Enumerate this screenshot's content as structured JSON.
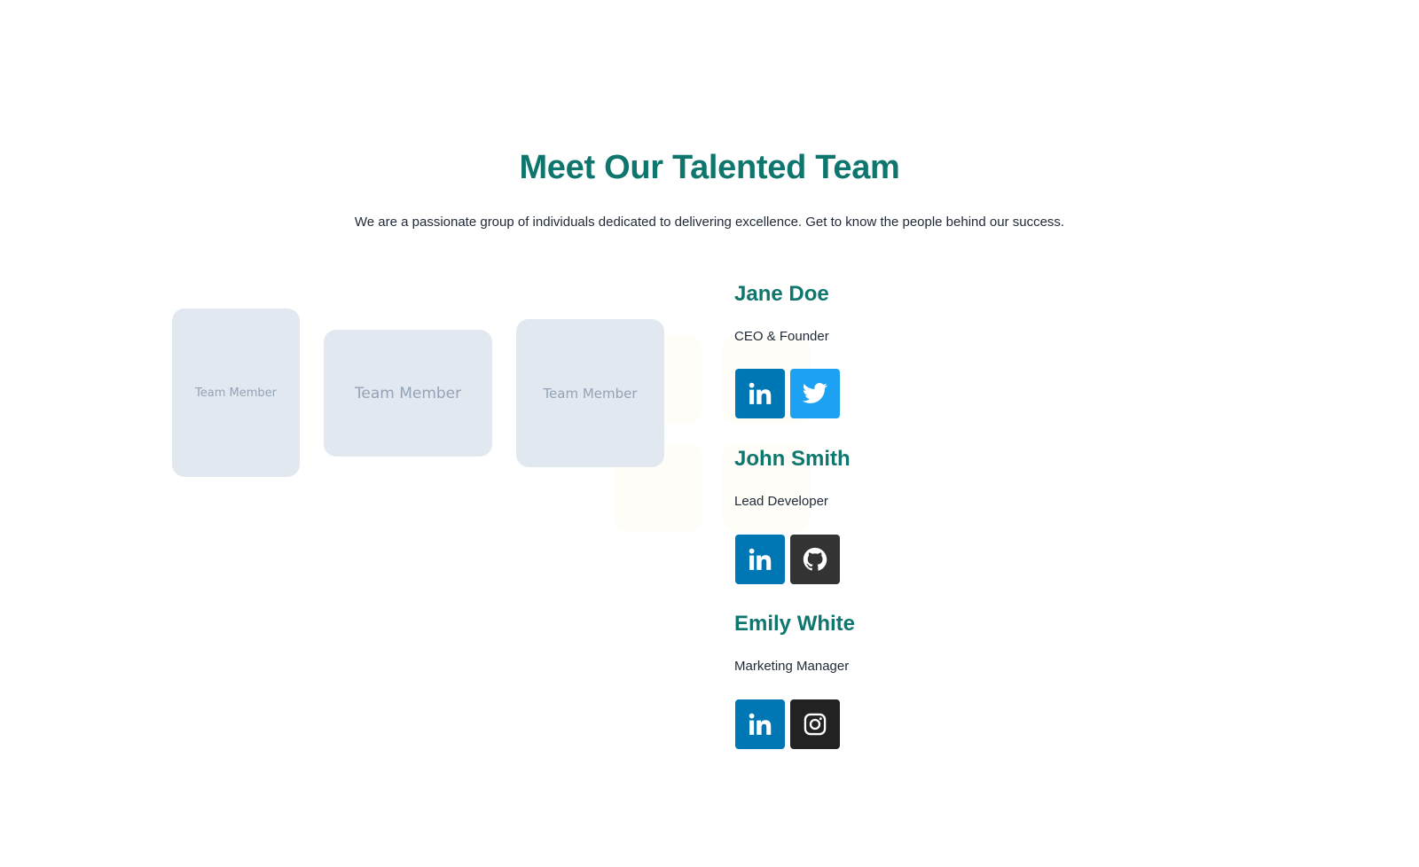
{
  "header": {
    "title": "Meet Our Talented Team",
    "subtitle": "We are a passionate group of individuals dedicated to delivering excellence. Get to know the people behind our success."
  },
  "cards": [
    {
      "label": "Team Member"
    },
    {
      "label": "Team Member"
    },
    {
      "label": "Team Member"
    }
  ],
  "members": [
    {
      "name": "Jane Doe",
      "role": "CEO & Founder",
      "socials": [
        {
          "icon": "linkedin-icon",
          "color": "#0077b5"
        },
        {
          "icon": "twitter-icon",
          "color": "#1da1f2"
        }
      ]
    },
    {
      "name": "John Smith",
      "role": "Lead Developer",
      "socials": [
        {
          "icon": "linkedin-icon",
          "color": "#0077b5"
        },
        {
          "icon": "github-icon",
          "color": "#333333"
        }
      ]
    },
    {
      "name": "Emily White",
      "role": "Marketing Manager",
      "socials": [
        {
          "icon": "linkedin-icon",
          "color": "#0077b5"
        },
        {
          "icon": "instagram-icon",
          "color": "#222222"
        }
      ]
    }
  ],
  "colors": {
    "accent": "#0f766e",
    "text": "#1f2937",
    "card_bg": "#e2e8f0",
    "card_text": "#94a3b8"
  }
}
